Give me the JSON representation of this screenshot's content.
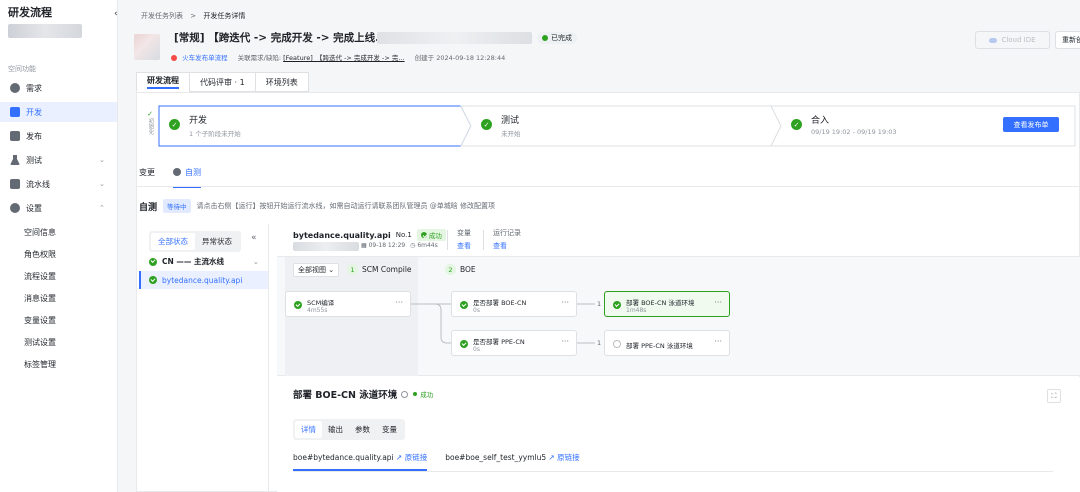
{
  "sidebar": {
    "title": "研发流程",
    "collapse_icon": "‹",
    "section_label": "空间功能",
    "items": [
      {
        "label": "需求",
        "icon": "bulb-icon",
        "color": "#646a73"
      },
      {
        "label": "开发",
        "icon": "code-icon",
        "color": "#3370ff"
      },
      {
        "label": "发布",
        "icon": "box-icon",
        "color": "#646a73"
      },
      {
        "label": "测试",
        "icon": "flask-icon",
        "color": "#646a73"
      },
      {
        "label": "流水线",
        "icon": "list-icon",
        "color": "#646a73"
      },
      {
        "label": "设置",
        "icon": "gear-icon",
        "color": "#646a73"
      }
    ],
    "settings_sub": [
      "空间信息",
      "角色权限",
      "流程设置",
      "消息设置",
      "变量设置",
      "测试设置",
      "标签管理"
    ]
  },
  "breadcrumb": {
    "parent": "开发任务列表",
    "sep": ">",
    "current": "开发任务详情"
  },
  "task": {
    "title": "[常规] 【跨迭代 -> 完成开发 -> 完成上线.",
    "status": "已完成",
    "workflow_link": "火车发布单流程",
    "related_label": "关联需求/缺陷:",
    "related_link": "[Feature]_【跨迭代 -> 完成开发 -> 完...",
    "created_at": "创建于 2024-09-18 12:28:44"
  },
  "header_buttons": {
    "cloud_ide": "Cloud IDE",
    "rebuild": "重新创"
  },
  "tabs": [
    "研发流程",
    "代码评审 · 1",
    "环境列表"
  ],
  "stages": {
    "init_label": "初始化",
    "items": [
      {
        "title": "开发",
        "sub": "1 个子阶段未开始"
      },
      {
        "title": "测试",
        "sub": "未开始"
      },
      {
        "title": "合入",
        "sub": "09/19 19:02 - 09/19 19:03"
      }
    ],
    "release_button": "查看发布单"
  },
  "subtabs": [
    "变更",
    "自测"
  ],
  "selftest": {
    "title": "自测",
    "tag": "等待中",
    "hint": "请点击右侧【运行】按钮开始运行流水线，如需自动运行请联系团队管理员 @单城晗 修改配置项"
  },
  "left_panel": {
    "state_tabs": [
      "全部状态",
      "异常状态"
    ],
    "collapse": "«",
    "group": "CN —— 主流水线",
    "item": "bytedance.quality.api"
  },
  "pipeline": {
    "name": "bytedance.quality.api",
    "no": "No.1",
    "status": "成功",
    "time": "09-18 12:29",
    "duration": "6m44s",
    "col_vars": {
      "label": "变量",
      "link": "查看"
    },
    "col_runs": {
      "label": "运行记录",
      "link": "查看"
    },
    "view_select": "全部视图 ⌄",
    "phases": [
      {
        "num": "1",
        "name": "SCM Compile"
      },
      {
        "num": "2",
        "name": "BOE"
      }
    ],
    "jobs": [
      {
        "name": "SCM编译",
        "time": "4m55s"
      },
      {
        "name": "是否部署 BOE-CN",
        "time": "0s"
      },
      {
        "name": "是否部署 PPE-CN",
        "time": "0s"
      },
      {
        "name": "部署 BOE-CN 泳道环境",
        "time": "1m48s"
      },
      {
        "name": "部署 PPE-CN 泳道环境",
        "time": ""
      }
    ],
    "edge_labels": [
      "1",
      "1"
    ]
  },
  "detail": {
    "title": "部署 BOE-CN 泳道环境",
    "status": "成功",
    "expand_icon": "⛶",
    "tabs": [
      "详情",
      "输出",
      "参数",
      "变量"
    ],
    "links": [
      {
        "name": "boe#bytedance.quality.api",
        "ext": "↗ 原链接"
      },
      {
        "name": "boe#boe_self_test_yymlu5",
        "ext": "↗ 原链接"
      }
    ]
  }
}
